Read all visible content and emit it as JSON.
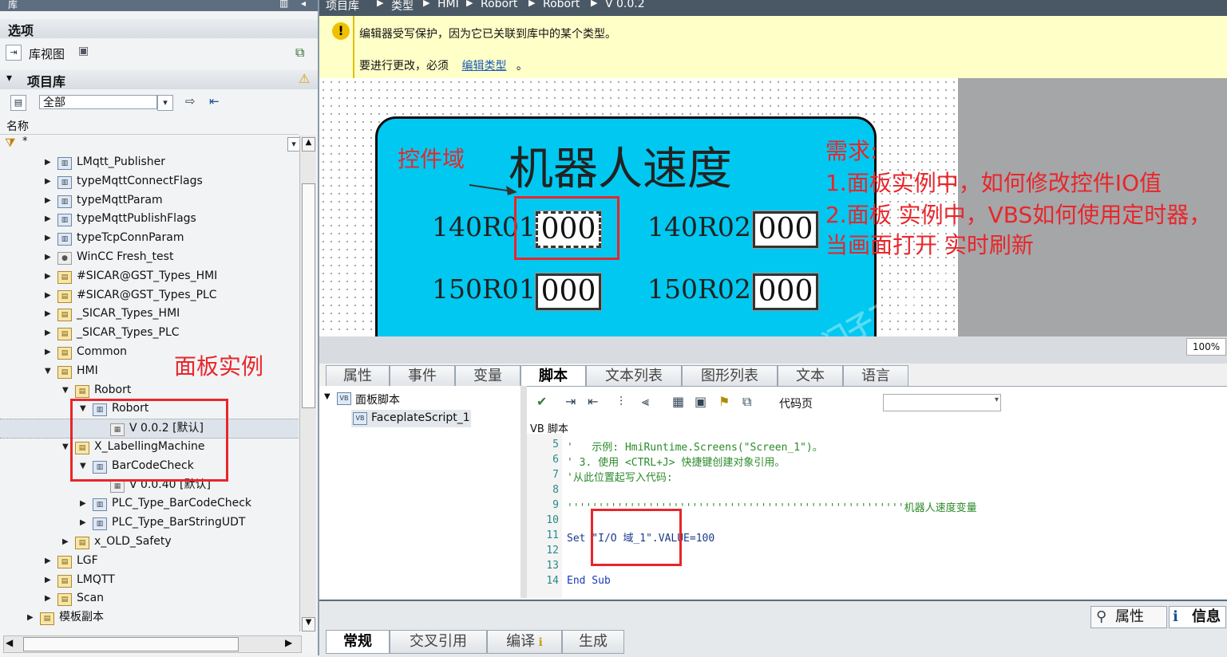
{
  "library": {
    "title": "库",
    "options_label": "选项",
    "library_view": "库视图",
    "project_library": "项目库",
    "filter_value": "全部",
    "name_header": "名称",
    "filter_symbol": "*",
    "tree": [
      {
        "label": "LMqtt_Publisher",
        "depth": 0,
        "expanded": false
      },
      {
        "label": "typeMqttConnectFlags",
        "depth": 0,
        "expanded": false
      },
      {
        "label": "typeMqttParam",
        "depth": 0,
        "expanded": false
      },
      {
        "label": "typeMqttPublishFlags",
        "depth": 0,
        "expanded": false
      },
      {
        "label": "typeTcpConnParam",
        "depth": 0,
        "expanded": false
      },
      {
        "label": "WinCC Fresh_test",
        "depth": 0,
        "expanded": false
      },
      {
        "label": "#SICAR@GST_Types_HMI",
        "depth": 0,
        "expanded": false
      },
      {
        "label": "#SICAR@GST_Types_PLC",
        "depth": 0,
        "expanded": false
      },
      {
        "label": "_SICAR_Types_HMI",
        "depth": 0,
        "expanded": false
      },
      {
        "label": "_SICAR_Types_PLC",
        "depth": 0,
        "expanded": false
      },
      {
        "label": "Common",
        "depth": 0,
        "expanded": false
      },
      {
        "label": "HMI",
        "depth": 0,
        "expanded": true
      },
      {
        "label": "Robort",
        "depth": 1,
        "expanded": true
      },
      {
        "label": "Robort",
        "depth": 2,
        "expanded": true
      },
      {
        "label": "V 0.0.2 [默认]",
        "depth": 3,
        "expanded": null
      },
      {
        "label": "X_LabellingMachine",
        "depth": 1,
        "expanded": true
      },
      {
        "label": "BarCodeCheck",
        "depth": 2,
        "expanded": true
      },
      {
        "label": "V 0.0.40 [默认]",
        "depth": 3,
        "expanded": null
      },
      {
        "label": "PLC_Type_BarCodeCheck",
        "depth": 2,
        "expanded": false
      },
      {
        "label": "PLC_Type_BarStringUDT",
        "depth": 2,
        "expanded": false
      },
      {
        "label": "x_OLD_Safety",
        "depth": 1,
        "expanded": false
      },
      {
        "label": "LGF",
        "depth": 0,
        "expanded": false
      },
      {
        "label": "LMQTT",
        "depth": 0,
        "expanded": false
      },
      {
        "label": "Scan",
        "depth": 0,
        "expanded": false
      },
      {
        "label": "模板副本",
        "depth": -1,
        "expanded": false
      }
    ]
  },
  "breadcrumb": [
    "项目库",
    "类型",
    "HMI",
    "Robort",
    "Robort",
    "V 0.0.2"
  ],
  "warning": {
    "line1": "编辑器受写保护，因为它已关联到库中的某个类型。",
    "line2_prefix": "要进行更改，必须",
    "link": "编辑类型",
    "line2_suffix": "。"
  },
  "faceplate": {
    "title": "机器人速度",
    "fields": [
      {
        "label": "140R01",
        "value": "000"
      },
      {
        "label": "140R02",
        "value": "000"
      },
      {
        "label": "150R01",
        "value": "000"
      },
      {
        "label": "150R02",
        "value": "000"
      }
    ]
  },
  "zoom": "100%",
  "tabs": [
    "属性",
    "事件",
    "变量",
    "脚本",
    "文本列表",
    "图形列表",
    "文本",
    "语言"
  ],
  "active_tab": "脚本",
  "script_tree": {
    "root": "面板脚本",
    "item": "FaceplateScript_1"
  },
  "script_toolbar": {
    "codepage_label": "代码页"
  },
  "script_header": "VB  脚本",
  "code_lines": [
    {
      "n": "5",
      "text": "'   示例: HmiRuntime.Screens(\"Screen_1\")。"
    },
    {
      "n": "6",
      "text": "' 3. 使用 <CTRL+J> 快捷键创建对象引用。"
    },
    {
      "n": "7",
      "text": "'从此位置起写入代码:"
    },
    {
      "n": "8",
      "text": ""
    },
    {
      "n": "9",
      "text": "''''''''''''''''''''''''''''''''''''''''''''''''''''''机器人速度变量"
    },
    {
      "n": "10",
      "text": ""
    },
    {
      "n": "11",
      "text": "Set \"I/O 域_1\".VALUE=100"
    },
    {
      "n": "12",
      "text": ""
    },
    {
      "n": "13",
      "text": ""
    },
    {
      "n": "14",
      "text": "End Sub"
    }
  ],
  "bottom_right": {
    "properties": "属性",
    "info": "信息"
  },
  "bottom_tabs": [
    "常规",
    "交叉引用",
    "编译",
    "生成"
  ],
  "annotations": {
    "control_field": "控件域",
    "panel_instance": "面板实例",
    "requirement_title": "需求:",
    "req1": "1.面板实例中，如何修改控件IO值",
    "req2": "2.面板 实例中，VBS如何使用定时器，",
    "req3": "当画面打开 实时刷新"
  },
  "watermark": "西门子工业 技术论坛",
  "watermark_url": "support.industry.siemens.com/cs",
  "colors": {
    "accent_red": "#e8262b",
    "faceplate_bg": "#00c8f0",
    "warning_bg": "#ffffc8"
  }
}
